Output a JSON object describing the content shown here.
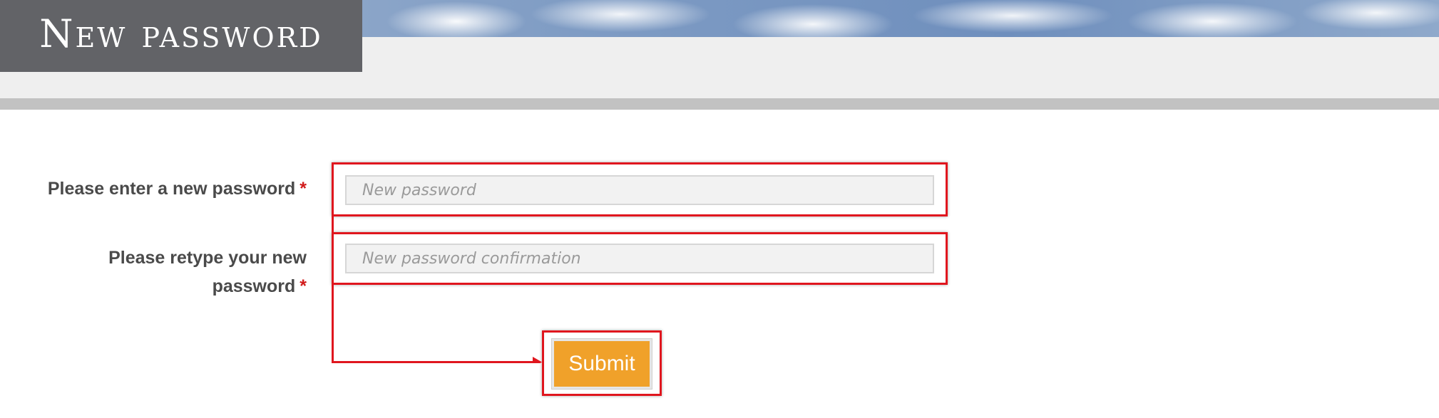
{
  "header": {
    "title": "New password"
  },
  "form": {
    "new_password": {
      "label": "Please enter a new password",
      "required_marker": "*",
      "placeholder": "New password",
      "value": ""
    },
    "confirm_password": {
      "label_line1": "Please retype your new",
      "label_line2": "password",
      "required_marker": "*",
      "placeholder": "New password confirmation",
      "value": ""
    },
    "submit_label": "Submit"
  },
  "colors": {
    "title_bg": "#626367",
    "button": "#f0a12a",
    "required": "#d11a1a",
    "annotation": "#e0161e"
  }
}
